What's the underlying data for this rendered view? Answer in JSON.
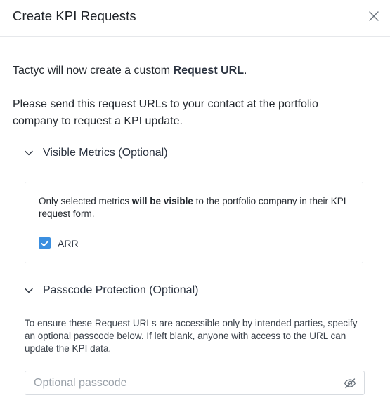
{
  "modal": {
    "title": "Create KPI Requests",
    "close_icon": "close-icon"
  },
  "intro": {
    "prefix": "Tactyc will now create a custom ",
    "emphasis": "Request URL",
    "suffix": "."
  },
  "send_text": "Please send this request URLs to your contact at the portfolio company to request a KPI update.",
  "visible_metrics": {
    "label": "Visible Metrics (Optional)",
    "expanded": true,
    "note_prefix": "Only selected metrics ",
    "note_emphasis": "will be visible",
    "note_suffix": " to the portfolio company in their KPI request form.",
    "metrics": [
      {
        "label": "ARR",
        "checked": true
      }
    ],
    "accent_color": "#3b8fe0"
  },
  "passcode": {
    "label": "Passcode Protection (Optional)",
    "expanded": true,
    "note": "To ensure these Request URLs are accessible only by intended parties, specify an optional passcode below. If left blank, anyone with access to the URL can update the KPI data.",
    "value": "",
    "placeholder": "Optional passcode",
    "toggle_icon": "eye-off-icon"
  }
}
